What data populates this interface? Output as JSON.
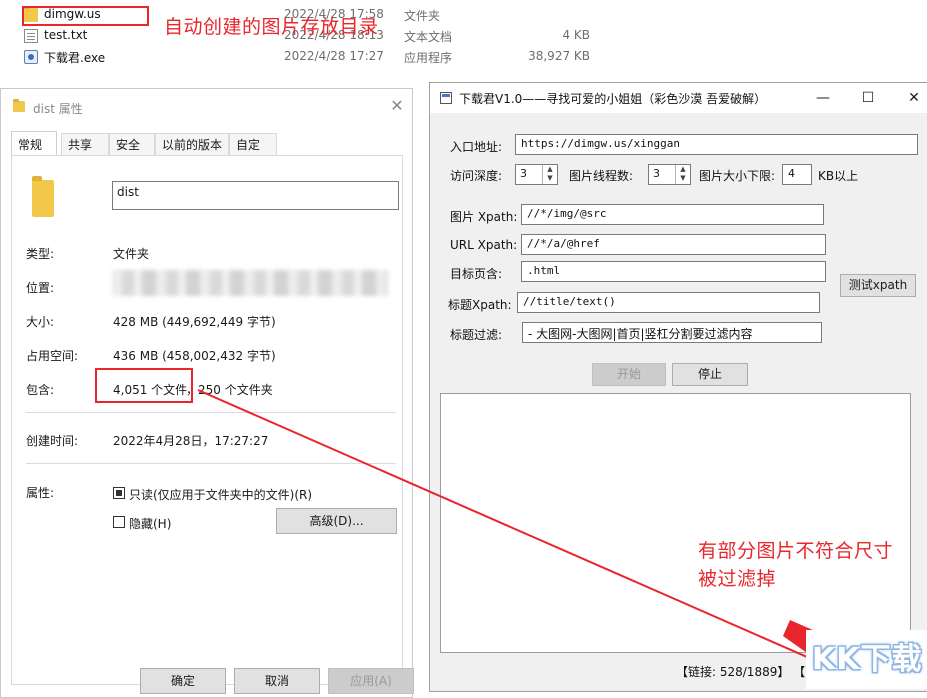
{
  "explorer": {
    "files": [
      {
        "name": "dimgw.us",
        "date": "2022/4/28 17:58",
        "type": "文件夹",
        "size": "",
        "icon": "folder-icon"
      },
      {
        "name": "test.txt",
        "date": "2022/4/28 18:13",
        "type": "文本文档",
        "size": "4 KB",
        "icon": "text-file-icon"
      },
      {
        "name": "下载君.exe",
        "date": "2022/4/28 17:27",
        "type": "应用程序",
        "size": "38,927 KB",
        "icon": "exe-icon"
      }
    ]
  },
  "annotations": {
    "folder_note": "自动创建的图片存放目录",
    "filter_note_line1": "有部分图片不符合尺寸",
    "filter_note_line2": "被过滤掉",
    "color": "#e8262b"
  },
  "properties": {
    "title": "dist 属性",
    "tabs": [
      "常规",
      "共享",
      "安全",
      "以前的版本",
      "自定义"
    ],
    "active_tab": "常规",
    "folder_name": "dist",
    "rows": {
      "type_label": "类型:",
      "type_value": "文件夹",
      "location_label": "位置:",
      "size_label": "大小:",
      "size_value": "428 MB (449,692,449 字节)",
      "disk_label": "占用空间:",
      "disk_value": "436 MB (458,002,432 字节)",
      "contains_label": "包含:",
      "contains_files": "4,051 个文件",
      "contains_folders": "，250 个文件夹",
      "created_label": "创建时间:",
      "created_value": "2022年4月28日，17:27:27",
      "attr_label": "属性:"
    },
    "readonly_label": "只读(仅应用于文件夹中的文件)(R)",
    "hidden_label": "隐藏(H)",
    "advanced_button": "高级(D)...",
    "ok_button": "确定",
    "cancel_button": "取消",
    "apply_button": "应用(A)"
  },
  "app": {
    "title": "下载君V1.0——寻找可爱的小姐姐（彩色沙漠 吾爱破解）",
    "entry_label": "入口地址:",
    "entry_value": "https://dimgw.us/xinggan",
    "depth_label": "访问深度:",
    "depth_value": "3",
    "threads_label": "图片线程数:",
    "threads_value": "3",
    "minsize_label": "图片大小下限:",
    "minsize_value": "4",
    "minsize_unit": "KB以上",
    "img_xpath_label": "图片 Xpath:",
    "img_xpath_value": "//*/img/@src",
    "url_xpath_label": "URL Xpath:",
    "url_xpath_value": "//*/a/@href",
    "target_label": "目标页含:",
    "target_value": ".html",
    "title_xpath_label": "标题Xpath:",
    "title_xpath_value": "//title/text()",
    "title_filter_label": "标题过滤:",
    "title_filter_value": "- 大图网-大图网|首页|竖杠分割要过滤内容",
    "test_button": "测试xpath",
    "start_button": "开始",
    "stop_button": "停止",
    "status": "【链接: 528/1889】 【"
  },
  "watermark": "KK下载"
}
